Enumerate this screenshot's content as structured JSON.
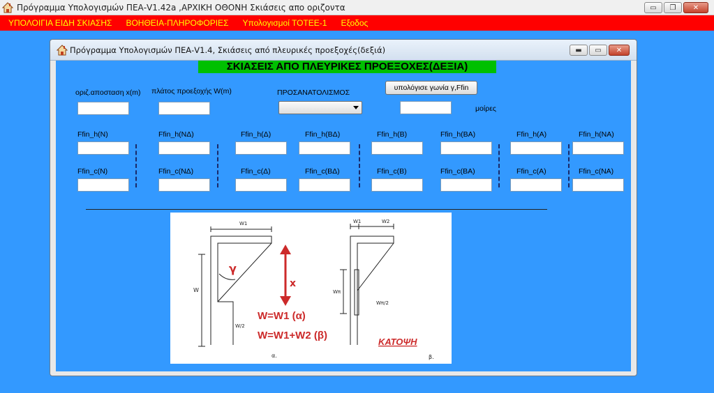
{
  "outer_window": {
    "title": "Πρόγραμμα Υπολογισμών ΠΕΑ-V1.42a ,ΑΡΧΙΚΗ ΟΘΟΝΗ  Σκιάσεις απο οριζοντα",
    "min_glyph": "▭",
    "max_glyph": "❐",
    "close_glyph": "✕"
  },
  "menubar": {
    "items": [
      "ΥΠΟΛΟΙΓΙΑ ΕΙΔΗ ΣΚΙΑΣΗΣ",
      "ΒΟΗΘΕΙΑ-ΠΛΗΡΟΦΟΡΙΕΣ",
      "Υπολογισμοί ΤΟΤΕΕ-1",
      "Εξοδος"
    ]
  },
  "inner_window": {
    "title": "Πρόγραμμα Υπολογισμών ΠΕΑ-V1.4, Σκιάσεις από πλευρικές προεξοχές(δεξιά)",
    "min_glyph": "▬",
    "max_glyph": "▭",
    "close_glyph": "✕"
  },
  "form": {
    "heading": "ΣΚΙΑΣΕΙΣ ΑΠΟ ΠΛΕΥΡΙΚΕΣ ΠΡΟΕΞΟΧΕΣ(ΔΕΞΙΑ)",
    "distance_label": "οριζ.αποσταση x(m)",
    "distance_value": "",
    "width_label": "πλάτος προεξοχής W(m)",
    "width_value": "",
    "orientation_label": "ΠΡΟΣΑΝΑΤΟΛΙΣΜΟΣ",
    "orientation_value": "",
    "calc_button": "υπολόγισε γωνία γ,Ffin",
    "angle_value": "",
    "degrees_label": "μοίρες"
  },
  "grid": {
    "h_labels": [
      "Ffin_h(N)",
      "Ffin_h(ΝΔ)",
      "Ffin_h(Δ)",
      "Ffin_h(ΒΔ)",
      "Ffin_h(Β)",
      "Ffin_h(ΒΑ)",
      "Ffin_h(A)",
      "Ffin_h(ΝΑ)"
    ],
    "c_labels": [
      "Ffin_c(N)",
      "Ffin_c(ΝΔ)",
      "Ffin_c(Δ)",
      "Ffin_c(ΒΔ)",
      "Ffin_c(Β)",
      "Ffin_c(ΒΑ)",
      "Ffin_c(A)",
      "Ffin_c(ΝΑ)"
    ]
  },
  "diagram": {
    "w1": "W1",
    "w2": "W2",
    "gamma": "γ",
    "w": "W",
    "w_half": "W/2",
    "x": "x",
    "wf": "Wπ",
    "wf_half": "Wπ/2",
    "formula1": "W=W1 (α)",
    "formula2": "W=W1+W2 (β)",
    "plan": "ΚΑΤΟΨΗ",
    "alpha": "α.",
    "beta": "β."
  },
  "colors": {
    "background": "#3399ff",
    "menubar": "#ff0000",
    "menu_text": "#ffff00",
    "heading_bg": "#00c000",
    "diagram_accent": "#cc2a2a"
  }
}
